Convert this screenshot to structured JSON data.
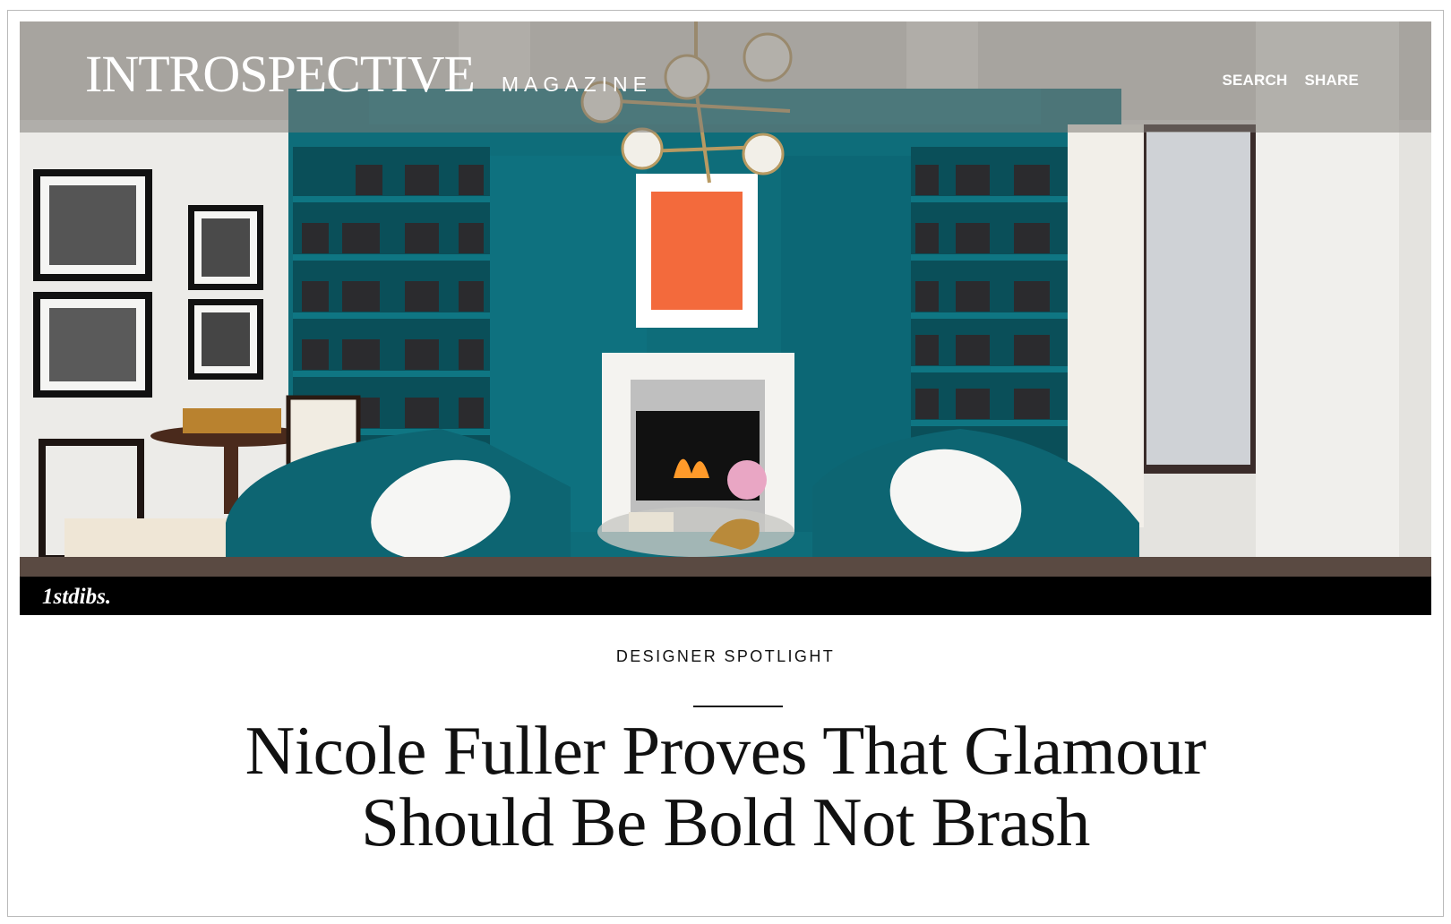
{
  "header": {
    "brand_main": "INTROSPECTIVE",
    "brand_sub": "MAGAZINE",
    "nav": {
      "search": "SEARCH",
      "share": "SHARE"
    }
  },
  "hero": {
    "credit": "1stdibs."
  },
  "article": {
    "kicker": "DESIGNER SPOTLIGHT",
    "headline_line1": "Nicole Fuller Proves That Glamour",
    "headline_line2": "Should Be Bold Not Brash"
  },
  "colors": {
    "teal_wall": "#0e6d7a",
    "sofa_teal": "#0d6572",
    "artwork_orange": "#f36a3c",
    "credit_bar": "#000000"
  }
}
